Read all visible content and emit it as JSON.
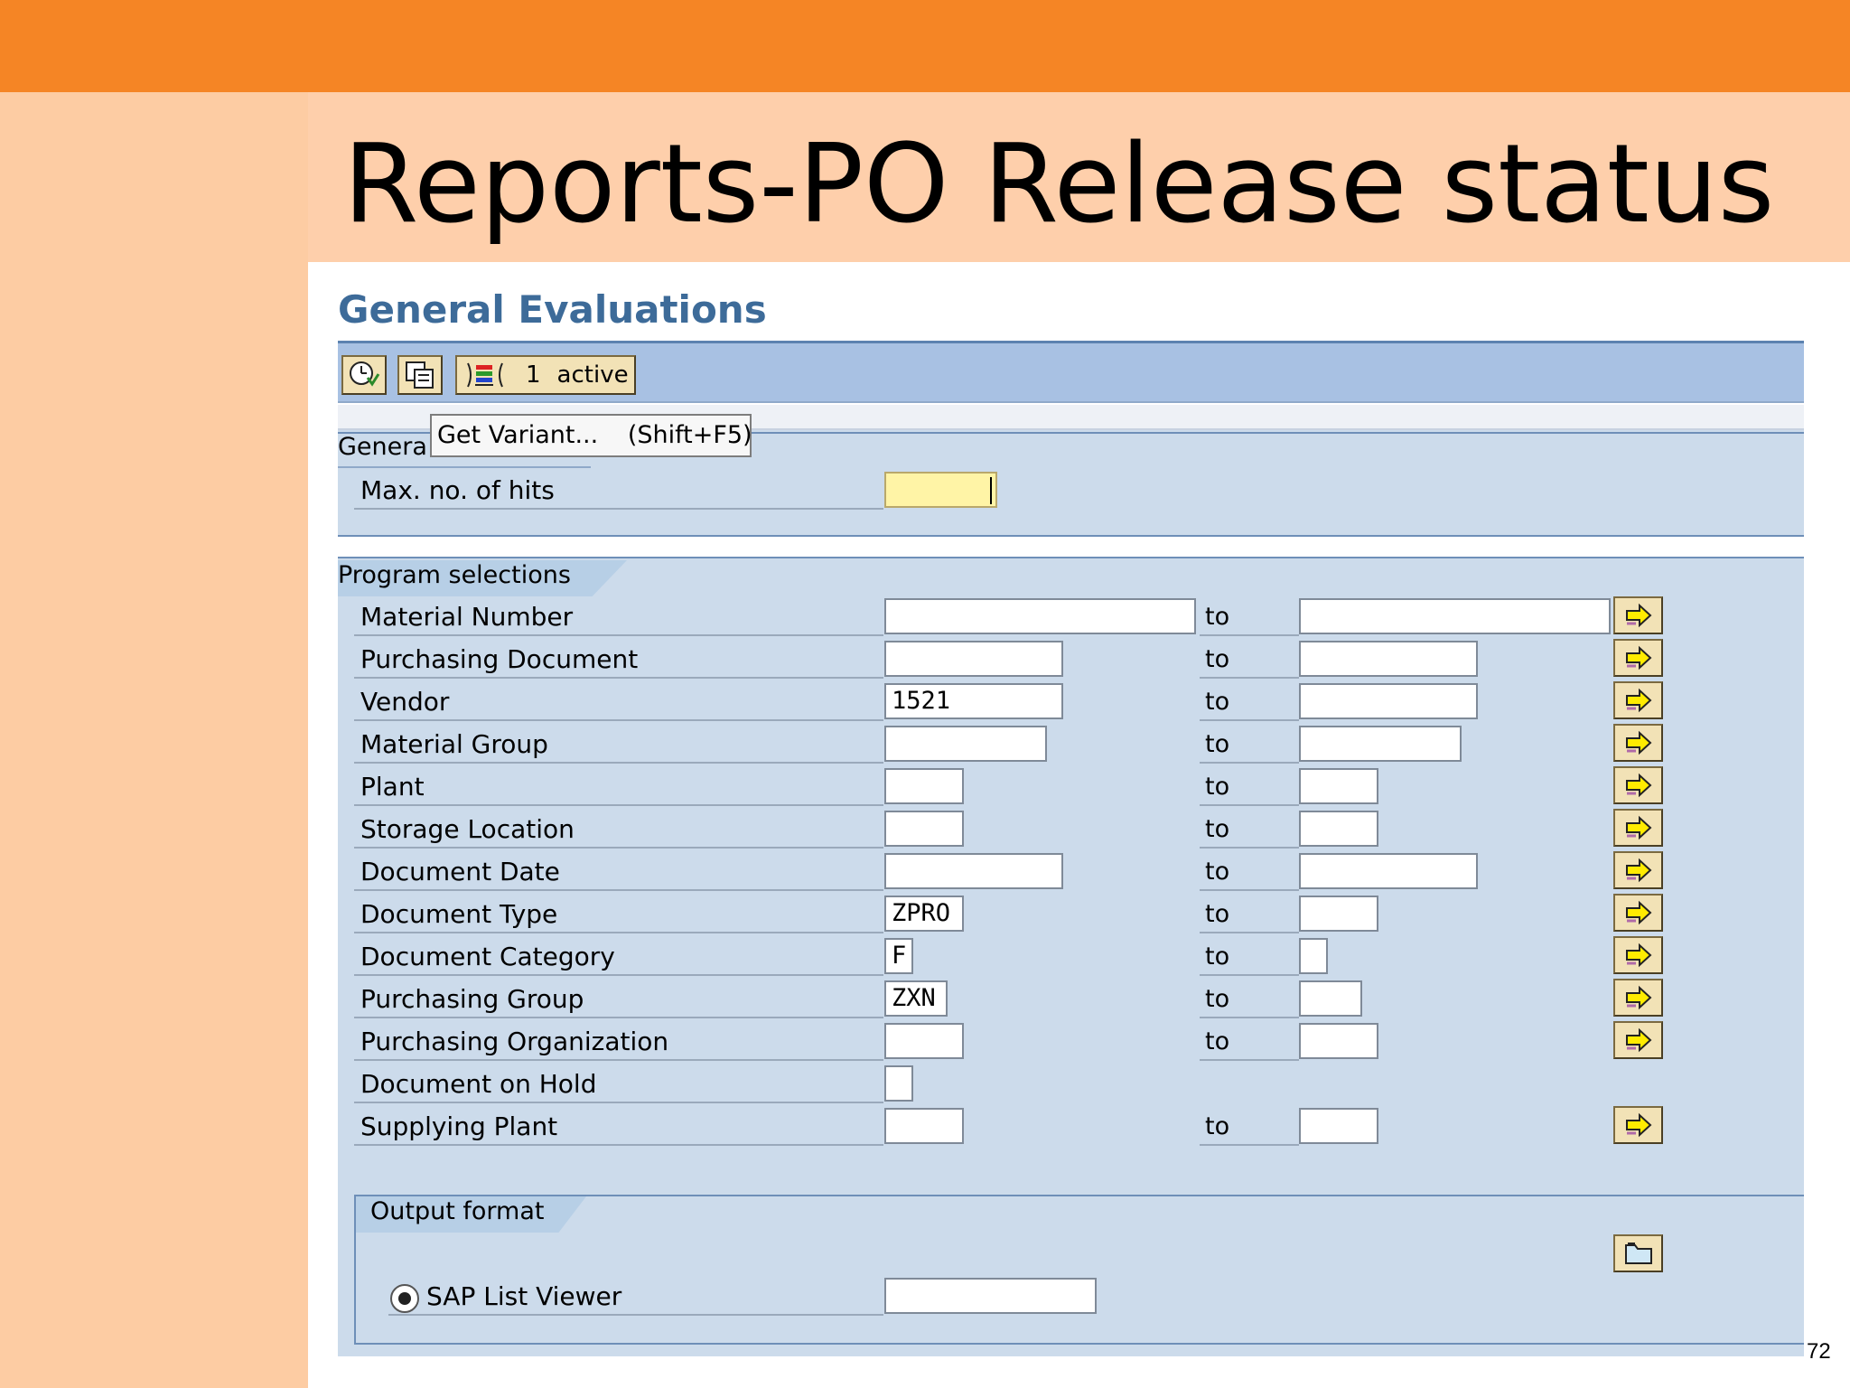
{
  "slide": {
    "title": "Reports-PO Release status",
    "page_number": "72"
  },
  "screen": {
    "title": "General Evaluations",
    "toolbar": {
      "active_count": "1",
      "active_label": "active"
    },
    "tooltip": {
      "label": "Get Variant...",
      "shortcut": "(Shift+F5)"
    },
    "general_group": {
      "label": "Genera",
      "max_hits_label": "Max. no. of hits",
      "max_hits_value": ""
    },
    "program_selections": {
      "label": "Program selections",
      "to_label": "to",
      "rows": [
        {
          "label": "Material Number",
          "from": "",
          "to": ""
        },
        {
          "label": "Purchasing Document",
          "from": "",
          "to": ""
        },
        {
          "label": "Vendor",
          "from": "1521",
          "to": ""
        },
        {
          "label": "Material Group",
          "from": "",
          "to": ""
        },
        {
          "label": "Plant",
          "from": "",
          "to": ""
        },
        {
          "label": "Storage Location",
          "from": "",
          "to": ""
        },
        {
          "label": "Document Date",
          "from": "",
          "to": ""
        },
        {
          "label": "Document Type",
          "from": "ZPRO",
          "to": ""
        },
        {
          "label": "Document Category",
          "from": "F",
          "to": ""
        },
        {
          "label": "Purchasing Group",
          "from": "ZXN",
          "to": ""
        },
        {
          "label": "Purchasing Organization",
          "from": "",
          "to": ""
        },
        {
          "label": "Document on Hold",
          "from": ""
        },
        {
          "label": "Supplying Plant",
          "from": "",
          "to": ""
        }
      ]
    },
    "output_format": {
      "label": "Output format",
      "option_label": "SAP List Viewer",
      "option_selected": true,
      "layout_value": ""
    }
  }
}
